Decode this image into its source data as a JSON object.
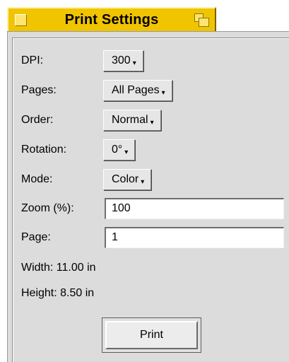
{
  "window": {
    "title": "Print Settings",
    "title_bar_color": "#f1c400",
    "close_icon": "close-box-icon",
    "zoom_icon": "zoom-box-icon"
  },
  "settings": {
    "dpi": {
      "label": "DPI:",
      "value": "300"
    },
    "pages": {
      "label": "Pages:",
      "value": "All Pages"
    },
    "order": {
      "label": "Order:",
      "value": "Normal"
    },
    "rotation": {
      "label": "Rotation:",
      "value": "0°"
    },
    "mode": {
      "label": "Mode:",
      "value": "Color"
    },
    "zoom": {
      "label": "Zoom (%):",
      "value": "100"
    },
    "page": {
      "label": "Page:",
      "value": "1"
    }
  },
  "info": {
    "width": "Width: 11.00 in",
    "height": "Height: 8.50 in"
  },
  "actions": {
    "print_label": "Print"
  },
  "menu_caret": "▾"
}
